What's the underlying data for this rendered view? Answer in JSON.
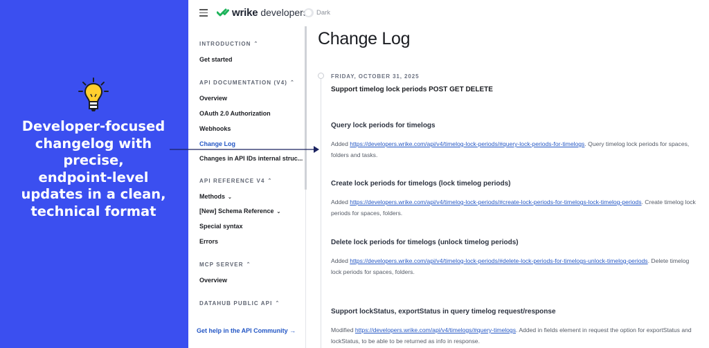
{
  "promo": {
    "text_lines": [
      "Developer-focused",
      "changelog with",
      "precise,",
      "endpoint-level",
      "updates in a clean,",
      "technical format"
    ],
    "background_color": "#3b4ff0",
    "icon": "lightbulb-icon"
  },
  "header": {
    "logo_word": "wrike",
    "logo_sub": "developers",
    "theme_toggle_label": "Dark",
    "brand_color": "#1db35a"
  },
  "sidebar": {
    "sections": [
      {
        "title": "INTRODUCTION",
        "items": [
          "Get started"
        ]
      },
      {
        "title": "API DOCUMENTATION (V4)",
        "items": [
          "Overview",
          "OAuth 2.0 Authorization",
          "Webhooks",
          "Change Log",
          "Changes in API IDs internal struc..."
        ]
      },
      {
        "title": "API REFERENCE V4",
        "items": [
          "Methods",
          "[New] Schema Reference",
          "Special syntax",
          "Errors"
        ]
      },
      {
        "title": "MCP SERVER",
        "items": [
          "Overview"
        ]
      },
      {
        "title": "DATAHUB PUBLIC API",
        "items": []
      }
    ],
    "active_item": "Change Log",
    "community_link": "Get help in the API Community →"
  },
  "main": {
    "title": "Change Log",
    "date": "FRIDAY, OCTOBER 31, 2025",
    "entry_title": "Support timelog lock periods POST GET DELETE",
    "blocks": [
      {
        "heading": "Query lock periods for timelogs",
        "verb": "Added",
        "url": "https://developers.wrike.com/api/v4/timelog-lock-periods/#query-lock-periods-for-timelogs",
        "text": ". Query timelog lock periods for spaces, folders and tasks."
      },
      {
        "heading": "Create lock periods for timelogs (lock timelog periods)",
        "verb": "Added",
        "url": "https://developers.wrike.com/api/v4/timelog-lock-periods/#create-lock-periods-for-timelogs-lock-timelog-periods",
        "text": ". Create timelog lock periods for spaces, folders."
      },
      {
        "heading": "Delete lock periods for timelogs (unlock timelog periods)",
        "verb": "Added",
        "url": "https://developers.wrike.com/api/v4/timelog-lock-periods/#delete-lock-periods-for-timelogs-unlock-timelog-periods",
        "text": ". Delete timelog lock periods for spaces, folders."
      },
      {
        "heading": "Support lockStatus, exportStatus in query timelog request/response",
        "verb": "Modified",
        "url": "https://developers.wrike.com/api/v4/timelogs/#query-timelogs",
        "text": ". Added in fields element in request the option for exportStatus and lockStatus, to be able to be returned as info in response."
      }
    ]
  }
}
